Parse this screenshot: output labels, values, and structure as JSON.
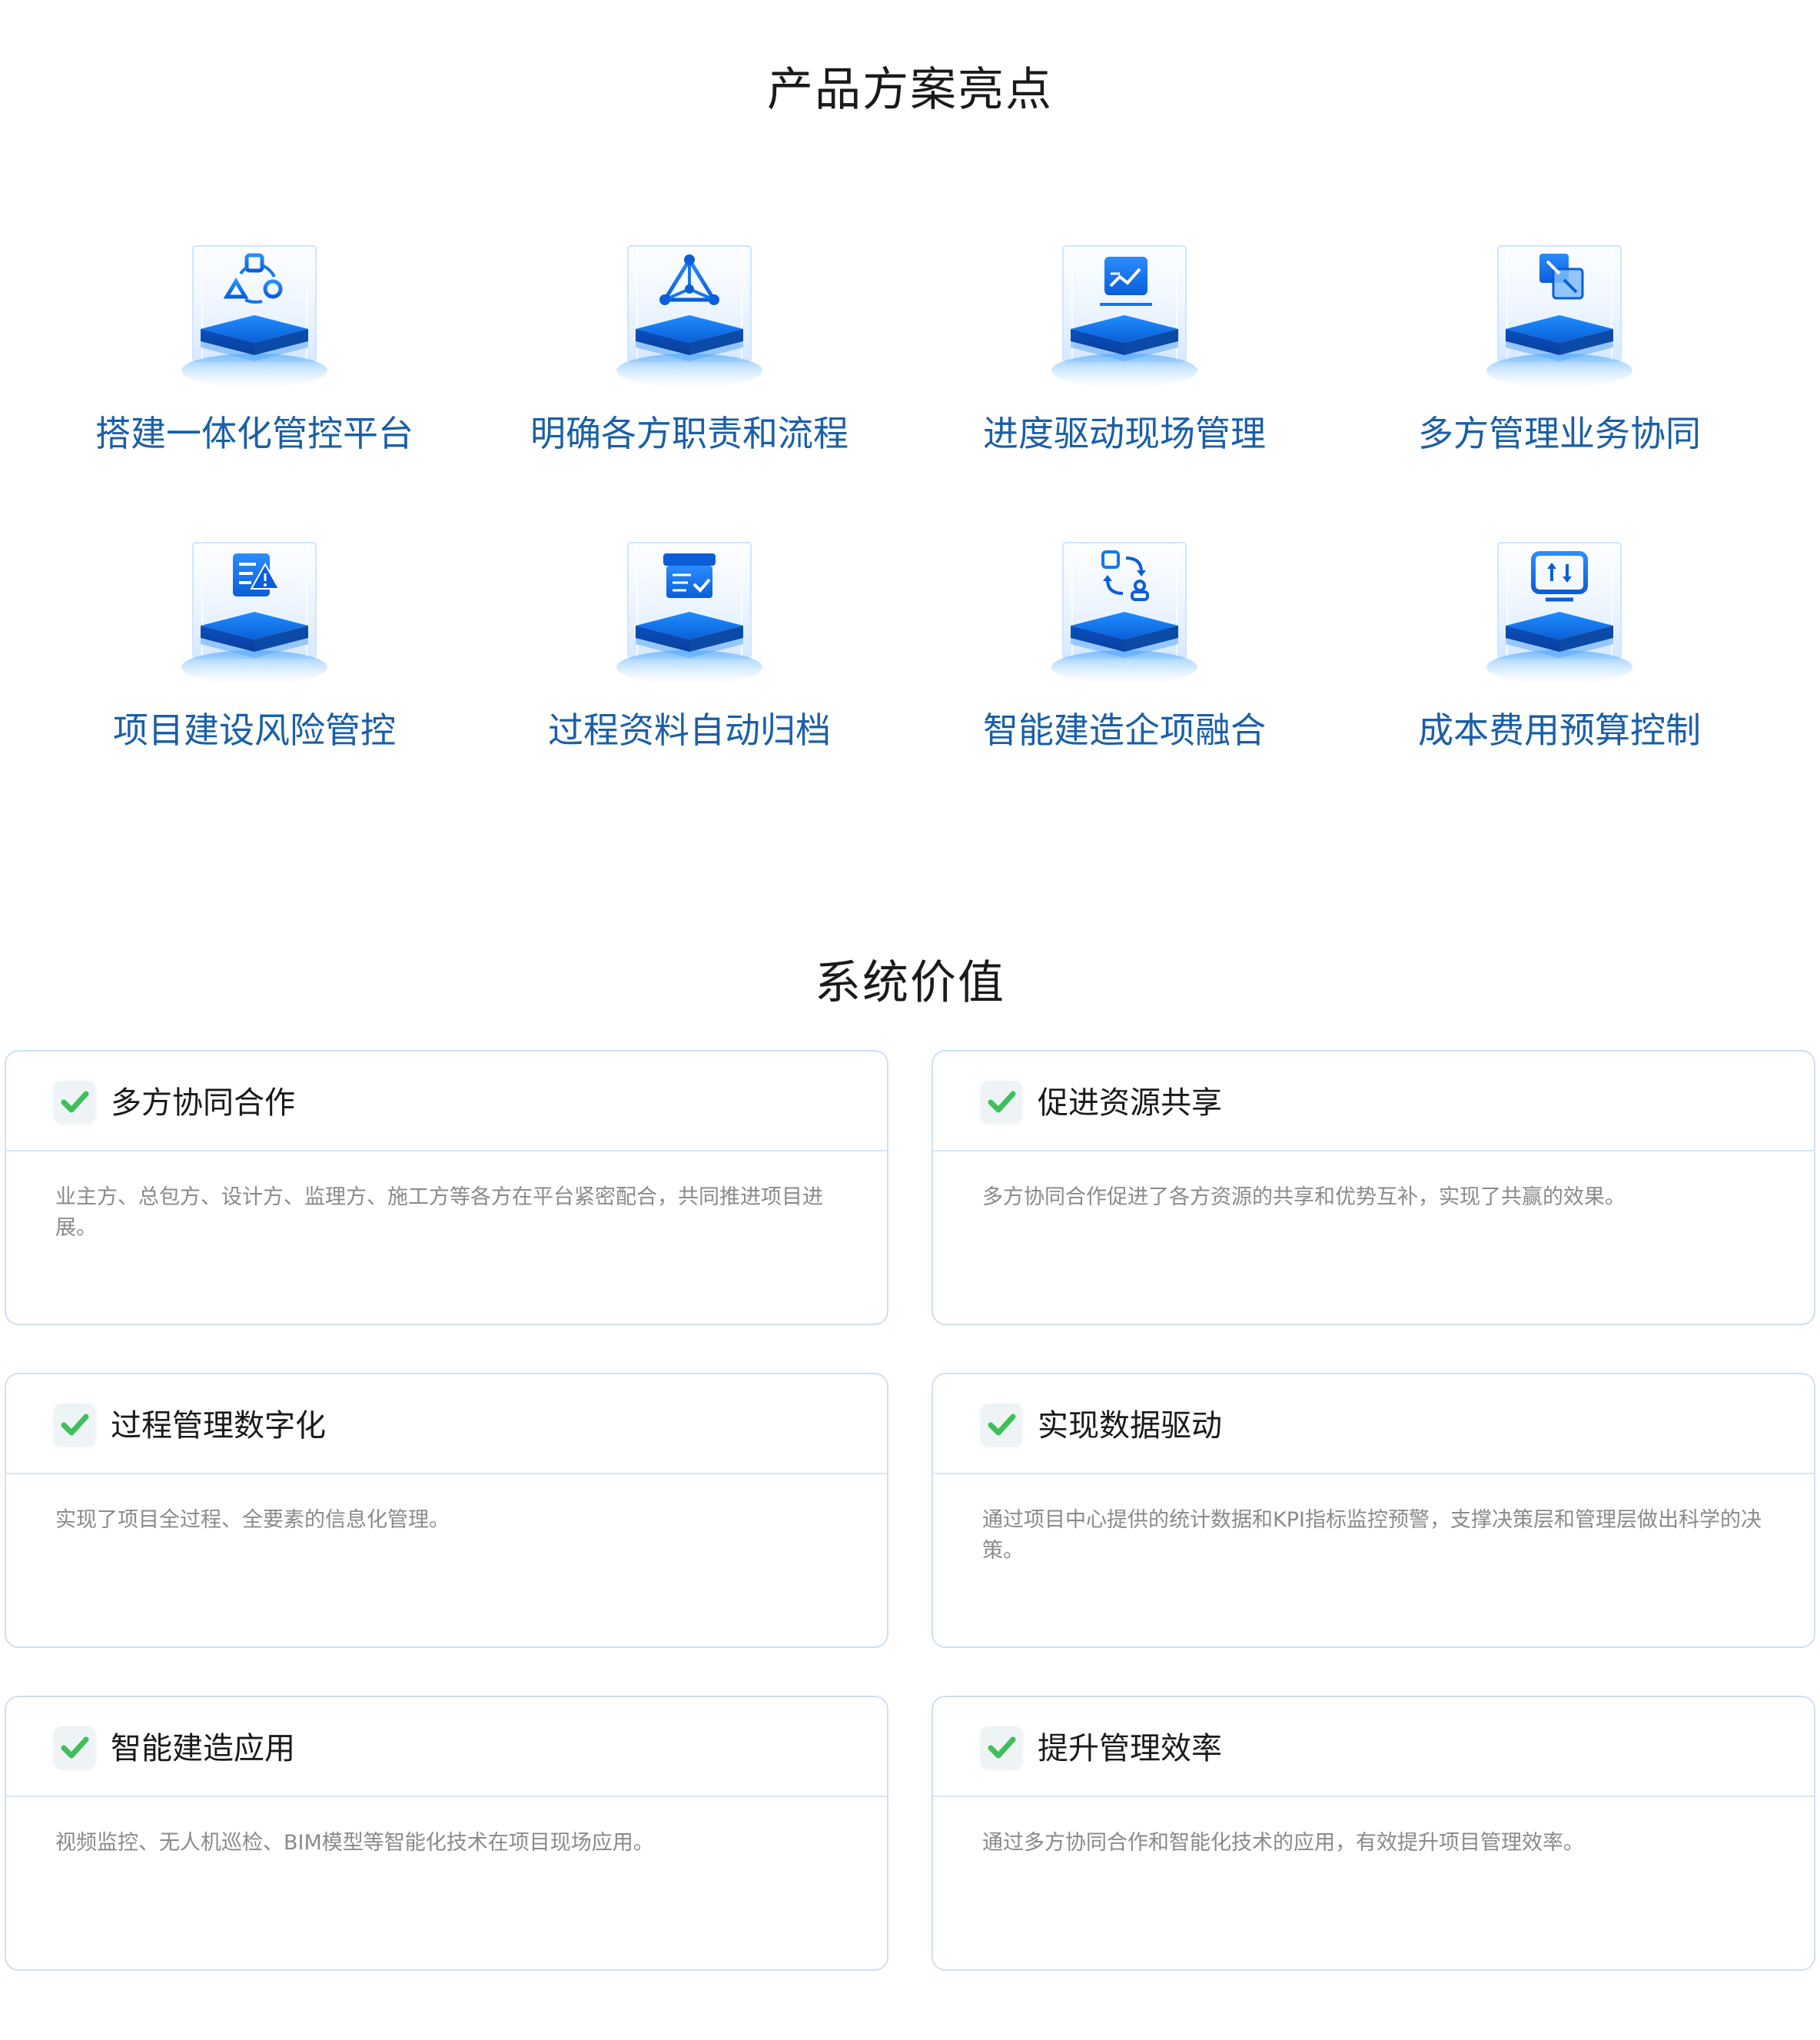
{
  "highlights": {
    "title": "产品方案亮点",
    "items": [
      {
        "label": "搭建一体化管控平台",
        "icon": "cycle-shapes-icon"
      },
      {
        "label": "明确各方职责和流程",
        "icon": "network-triangle-icon"
      },
      {
        "label": "进度驱动现场管理",
        "icon": "progress-chart-icon"
      },
      {
        "label": "多方管理业务协同",
        "icon": "collaborate-arrows-icon"
      },
      {
        "label": "项目建设风险管控",
        "icon": "risk-warning-icon"
      },
      {
        "label": "过程资料自动归档",
        "icon": "archive-box-icon"
      },
      {
        "label": "智能建造企项融合",
        "icon": "sync-user-icon"
      },
      {
        "label": "成本费用预算控制",
        "icon": "budget-monitor-icon"
      }
    ]
  },
  "values": {
    "title": "系统价值",
    "cards": [
      {
        "title": "多方协同合作",
        "desc": "业主方、总包方、设计方、监理方、施工方等各方在平台紧密配合，共同推进项目进展。"
      },
      {
        "title": "促进资源共享",
        "desc": "多方协同合作促进了各方资源的共享和优势互补，实现了共赢的效果。"
      },
      {
        "title": "过程管理数字化",
        "desc": "实现了项目全过程、全要素的信息化管理。"
      },
      {
        "title": "实现数据驱动",
        "desc": "通过项目中心提供的统计数据和KPI指标监控预警，支撑决策层和管理层做出科学的决策。"
      },
      {
        "title": "智能建造应用",
        "desc": "视频监控、无人机巡检、BIM模型等智能化技术在项目现场应用。"
      },
      {
        "title": "提升管理效率",
        "desc": "通过多方协同合作和智能化技术的应用，有效提升项目管理效率。"
      }
    ]
  },
  "colors": {
    "accent": "#1a5fa8",
    "icon_blue": "#1677e8",
    "check_green": "#3fbf5a",
    "card_border": "#cfe0f2"
  }
}
